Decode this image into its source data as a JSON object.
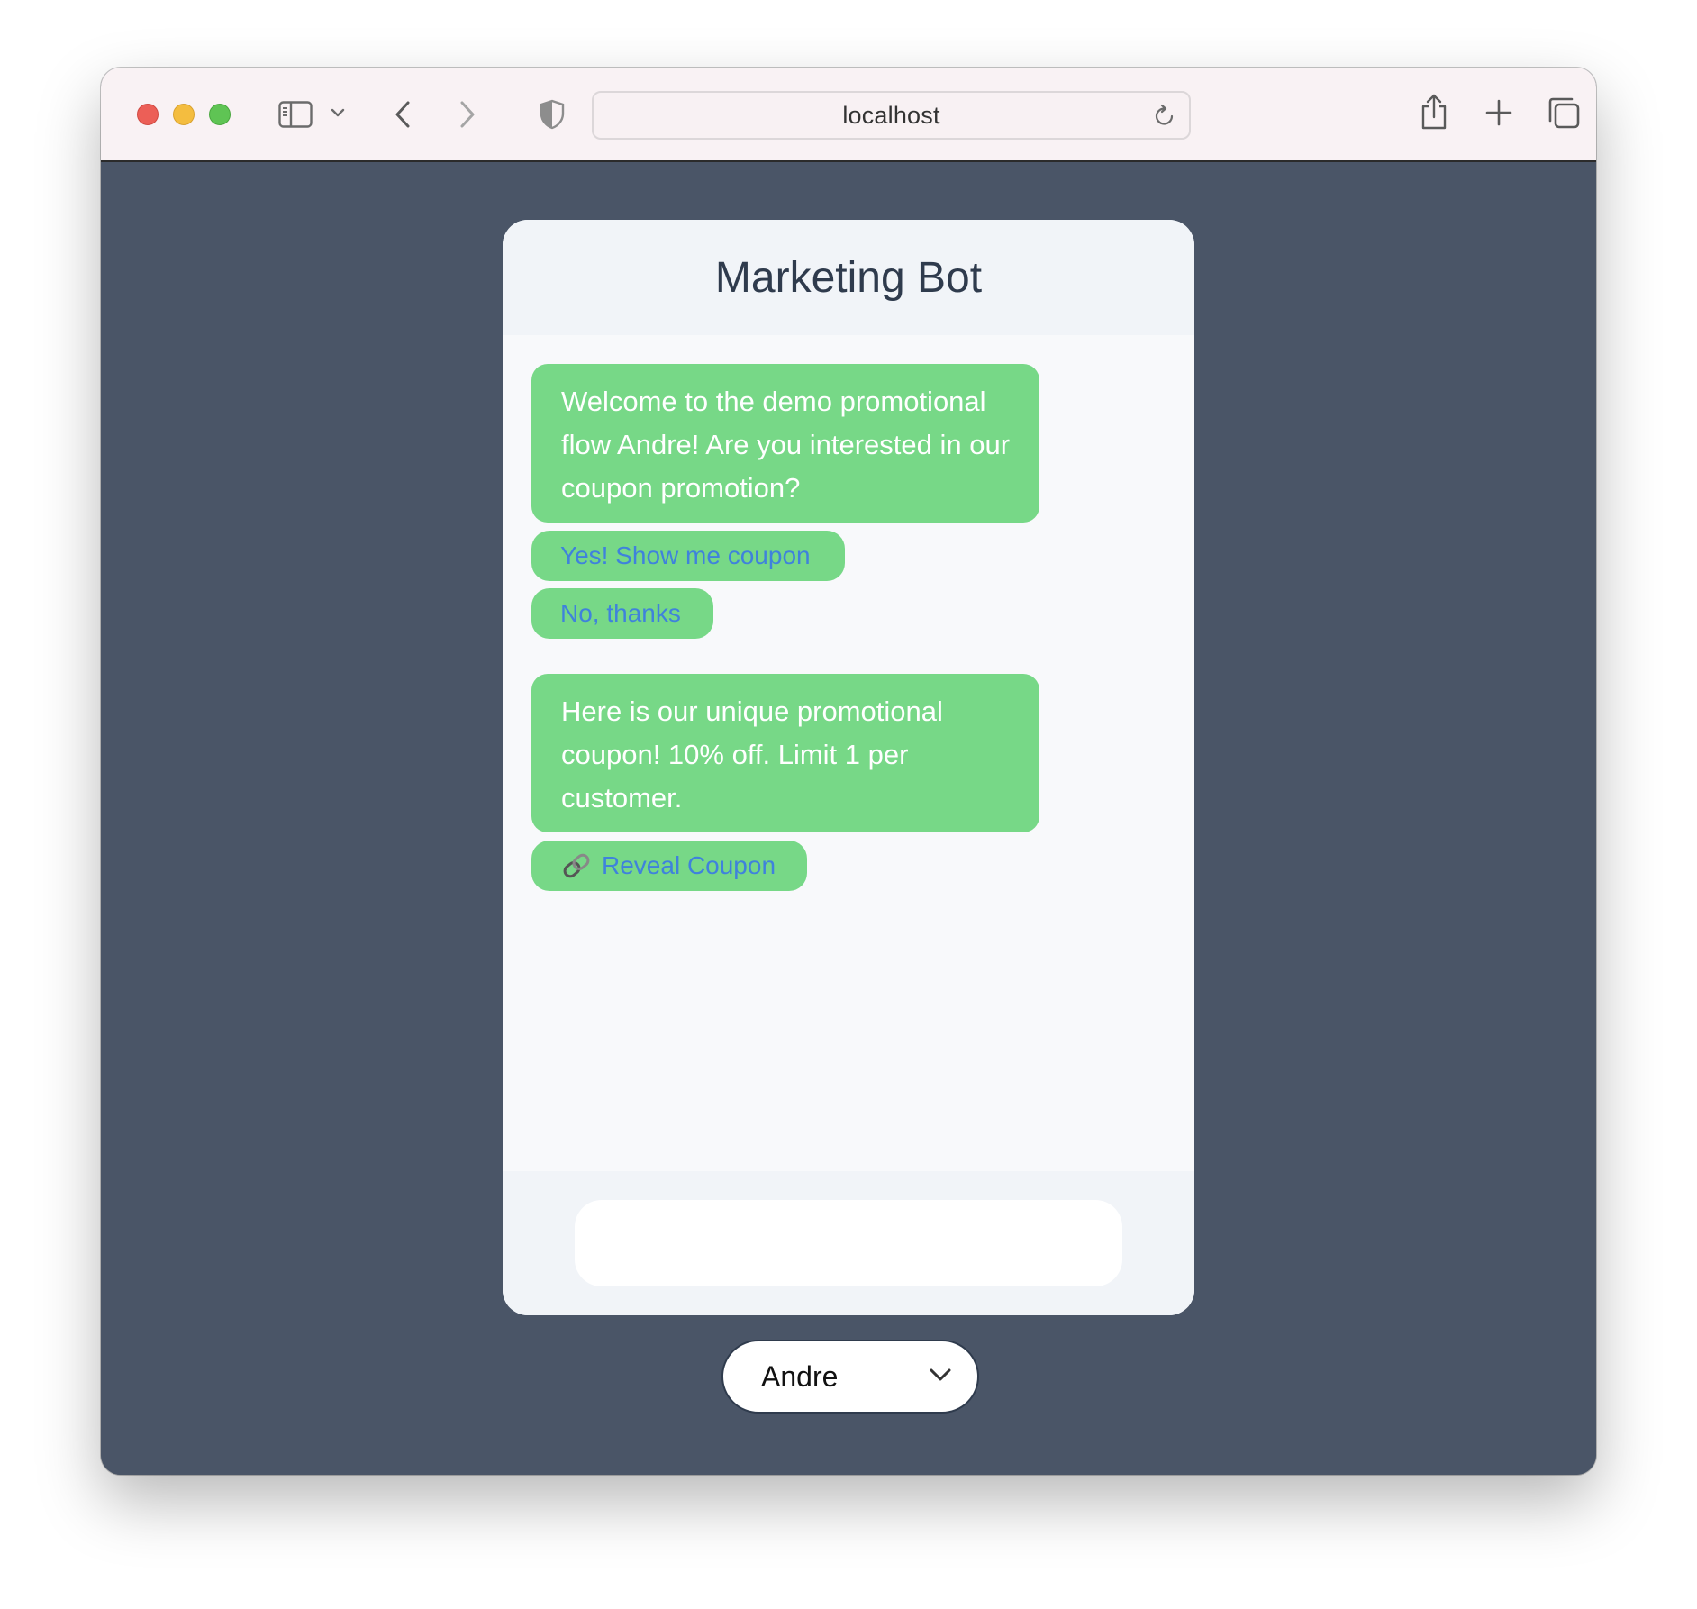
{
  "browser": {
    "address": "localhost"
  },
  "chat": {
    "title": "Marketing Bot",
    "messages": [
      {
        "text": "Welcome to the demo promotional flow Andre! Are you interested in our coupon promotion?"
      },
      {
        "text": "Here is our unique promotional coupon! 10% off. Limit 1 per customer."
      }
    ],
    "quick_replies": [
      {
        "label": "Yes! Show me coupon"
      },
      {
        "label": "No, thanks"
      }
    ],
    "link_button": {
      "label": "Reveal Coupon",
      "icon": "link-icon"
    },
    "input": {
      "value": "",
      "placeholder": ""
    }
  },
  "user_selector": {
    "selected": "Andre"
  },
  "colors": {
    "page_background": "#4a5567",
    "bubble": "#77d887",
    "quick_reply_text": "#3f82dc",
    "title_text": "#2f3b4d"
  }
}
